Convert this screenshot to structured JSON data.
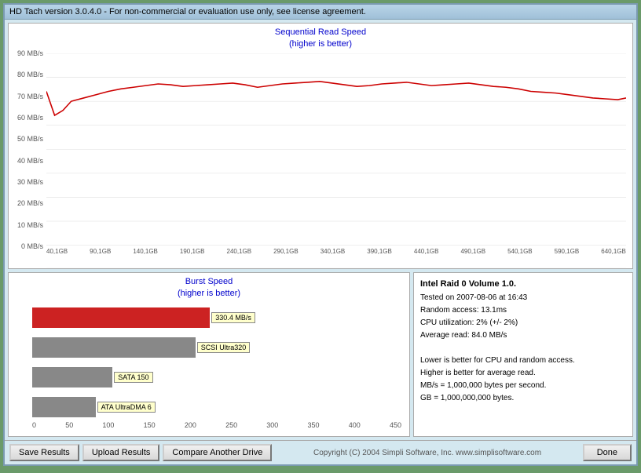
{
  "window": {
    "title": "HD Tach version 3.0.4.0  - For non-commercial or evaluation use only, see license agreement."
  },
  "seq_chart": {
    "title_line1": "Sequential Read Speed",
    "title_line2": "(higher is better)",
    "y_labels": [
      "90 MB/s",
      "80 MB/s",
      "70 MB/s",
      "60 MB/s",
      "50 MB/s",
      "40 MB/s",
      "30 MB/s",
      "20 MB/s",
      "10 MB/s",
      "0 MB/s"
    ],
    "x_labels": [
      "40,1GB",
      "90,1GB",
      "140,1GB",
      "190,1GB",
      "240,1GB",
      "290,1GB",
      "340,1GB",
      "390,1GB",
      "440,1GB",
      "490,1GB",
      "540,1GB",
      "590,1GB",
      "640,1GB"
    ]
  },
  "burst_chart": {
    "title_line1": "Burst Speed",
    "title_line2": "(higher is better)",
    "bars": [
      {
        "color": "#cc2222",
        "width_pct": 73,
        "label": "330.4 MB/s"
      },
      {
        "color": "#888888",
        "width_pct": 67,
        "label": "SCSI Ultra320"
      },
      {
        "color": "#888888",
        "width_pct": 33,
        "label": "SATA 150"
      },
      {
        "color": "#888888",
        "width_pct": 26,
        "label": "ATA UltraDMA 6"
      }
    ],
    "x_labels": [
      "0",
      "50",
      "100",
      "150",
      "200",
      "250",
      "300",
      "350",
      "400",
      "450"
    ]
  },
  "info_panel": {
    "title": "Intel Raid 0 Volume 1.0.",
    "line1": "Tested on 2007-08-06 at 16:43",
    "line2": "Random access: 13.1ms",
    "line3": "CPU utilization: 2% (+/- 2%)",
    "line4": "Average read: 84.0 MB/s",
    "line5": "",
    "line6": "Lower is better for CPU and random access.",
    "line7": "Higher is better for average read.",
    "line8": "MB/s = 1,000,000 bytes per second.",
    "line9": "GB = 1,000,000,000 bytes."
  },
  "buttons": {
    "save_results": "Save Results",
    "upload_results": "Upload Results",
    "compare_drive": "Compare Another Drive",
    "done": "Done"
  },
  "copyright": "Copyright (C) 2004 Simpli Software, Inc. www.simplisoftware.com"
}
